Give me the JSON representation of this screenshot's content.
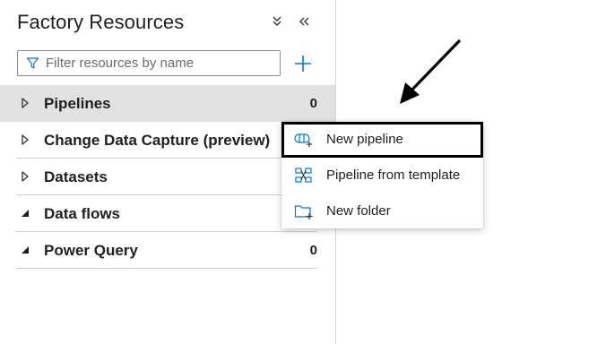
{
  "panel": {
    "title": "Factory Resources",
    "filter_placeholder": "Filter resources by name",
    "filter_value": ""
  },
  "header_icons": {
    "collapse_all": "chevrons-down-icon",
    "hide_panel": "chevrons-left-icon",
    "add": "plus-icon",
    "filter": "filter-icon"
  },
  "tree": {
    "items": [
      {
        "label": "Pipelines",
        "count": "0",
        "expanded": false,
        "selected": true
      },
      {
        "label": "Change Data Capture (preview)",
        "count": "",
        "expanded": false,
        "selected": false
      },
      {
        "label": "Datasets",
        "count": "",
        "expanded": false,
        "selected": false
      },
      {
        "label": "Data flows",
        "count": "",
        "expanded": true,
        "selected": false
      },
      {
        "label": "Power Query",
        "count": "0",
        "expanded": true,
        "selected": false
      }
    ]
  },
  "context_menu": {
    "items": [
      {
        "label": "New pipeline",
        "icon": "pipeline-add-icon",
        "highlighted": true
      },
      {
        "label": "Pipeline from template",
        "icon": "template-icon",
        "highlighted": false
      },
      {
        "label": "New folder",
        "icon": "folder-add-icon",
        "highlighted": false
      }
    ]
  },
  "colors": {
    "accent": "#0078d4",
    "selected_row": "#e1e1e1",
    "annotation": "#000000"
  }
}
